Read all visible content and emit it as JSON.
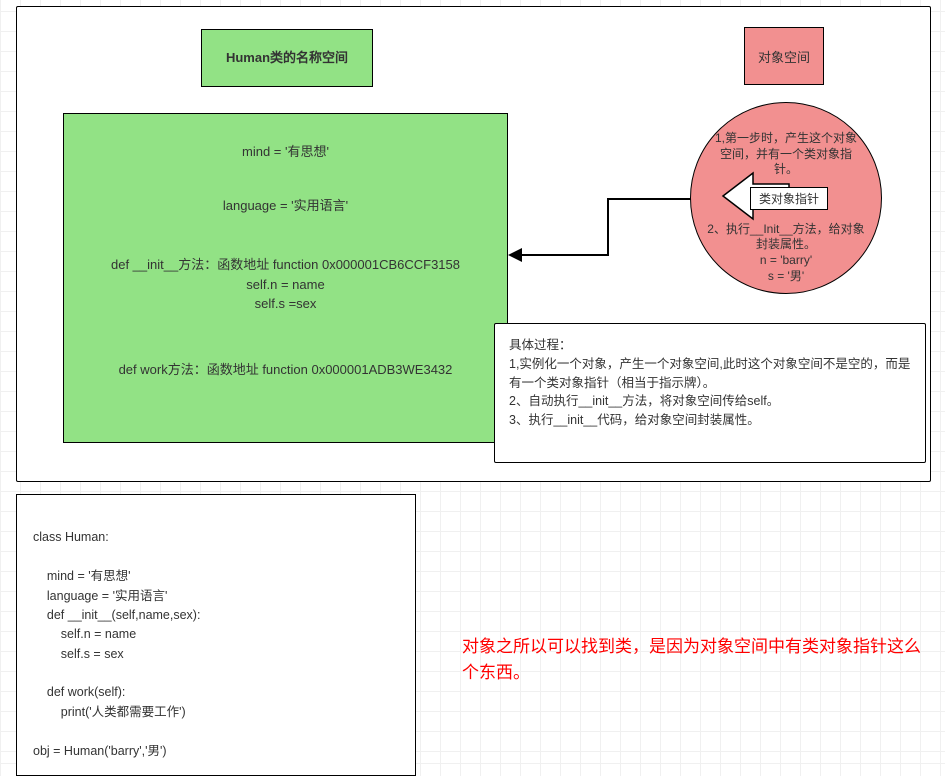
{
  "mainPanel": {
    "classSpace": {
      "title": "Human类的名称空间",
      "line1": "mind = '有思想'",
      "line2": "language = '实用语言'",
      "line3a": "def __init__方法：函数地址 function 0x000001CB6CCF3158",
      "line3b": "self.n = name",
      "line3c": "self.s =sex",
      "line4": "def work方法：函数地址 function 0x000001ADB3WE3432"
    },
    "objectSpace": {
      "title": "对象空间",
      "circleTop": "1,第一步时，产生这个对象空间，并有一个类对象指针。",
      "pointerLabel": "类对象指针",
      "circleBottom1": "2、执行__Init__方法，给对象封装属性。",
      "circleBottom2": "n = 'barry'",
      "circleBottom3": "s = '男'"
    },
    "process": {
      "heading": "具体过程：",
      "step1": "1,实例化一个对象，产生一个对象空间,此时这个对象空间不是空的，而是有一个类对象指针（相当于指示牌）。",
      "step2": "2、自动执行__init__方法，将对象空间传给self。",
      "step3": "3、执行__init__代码，给对象空间封装属性。"
    }
  },
  "code": {
    "text": "class Human:\n\n    mind = '有思想'\n    language = '实用语言'\n    def __init__(self,name,sex):\n        self.n = name\n        self.s = sex\n\n    def work(self):\n        print('人类都需要工作')\n\nobj = Human('barry','男')"
  },
  "redNote": {
    "text": "对象之所以可以找到类，是因为对象空间中有类对象指针这么个东西。"
  }
}
